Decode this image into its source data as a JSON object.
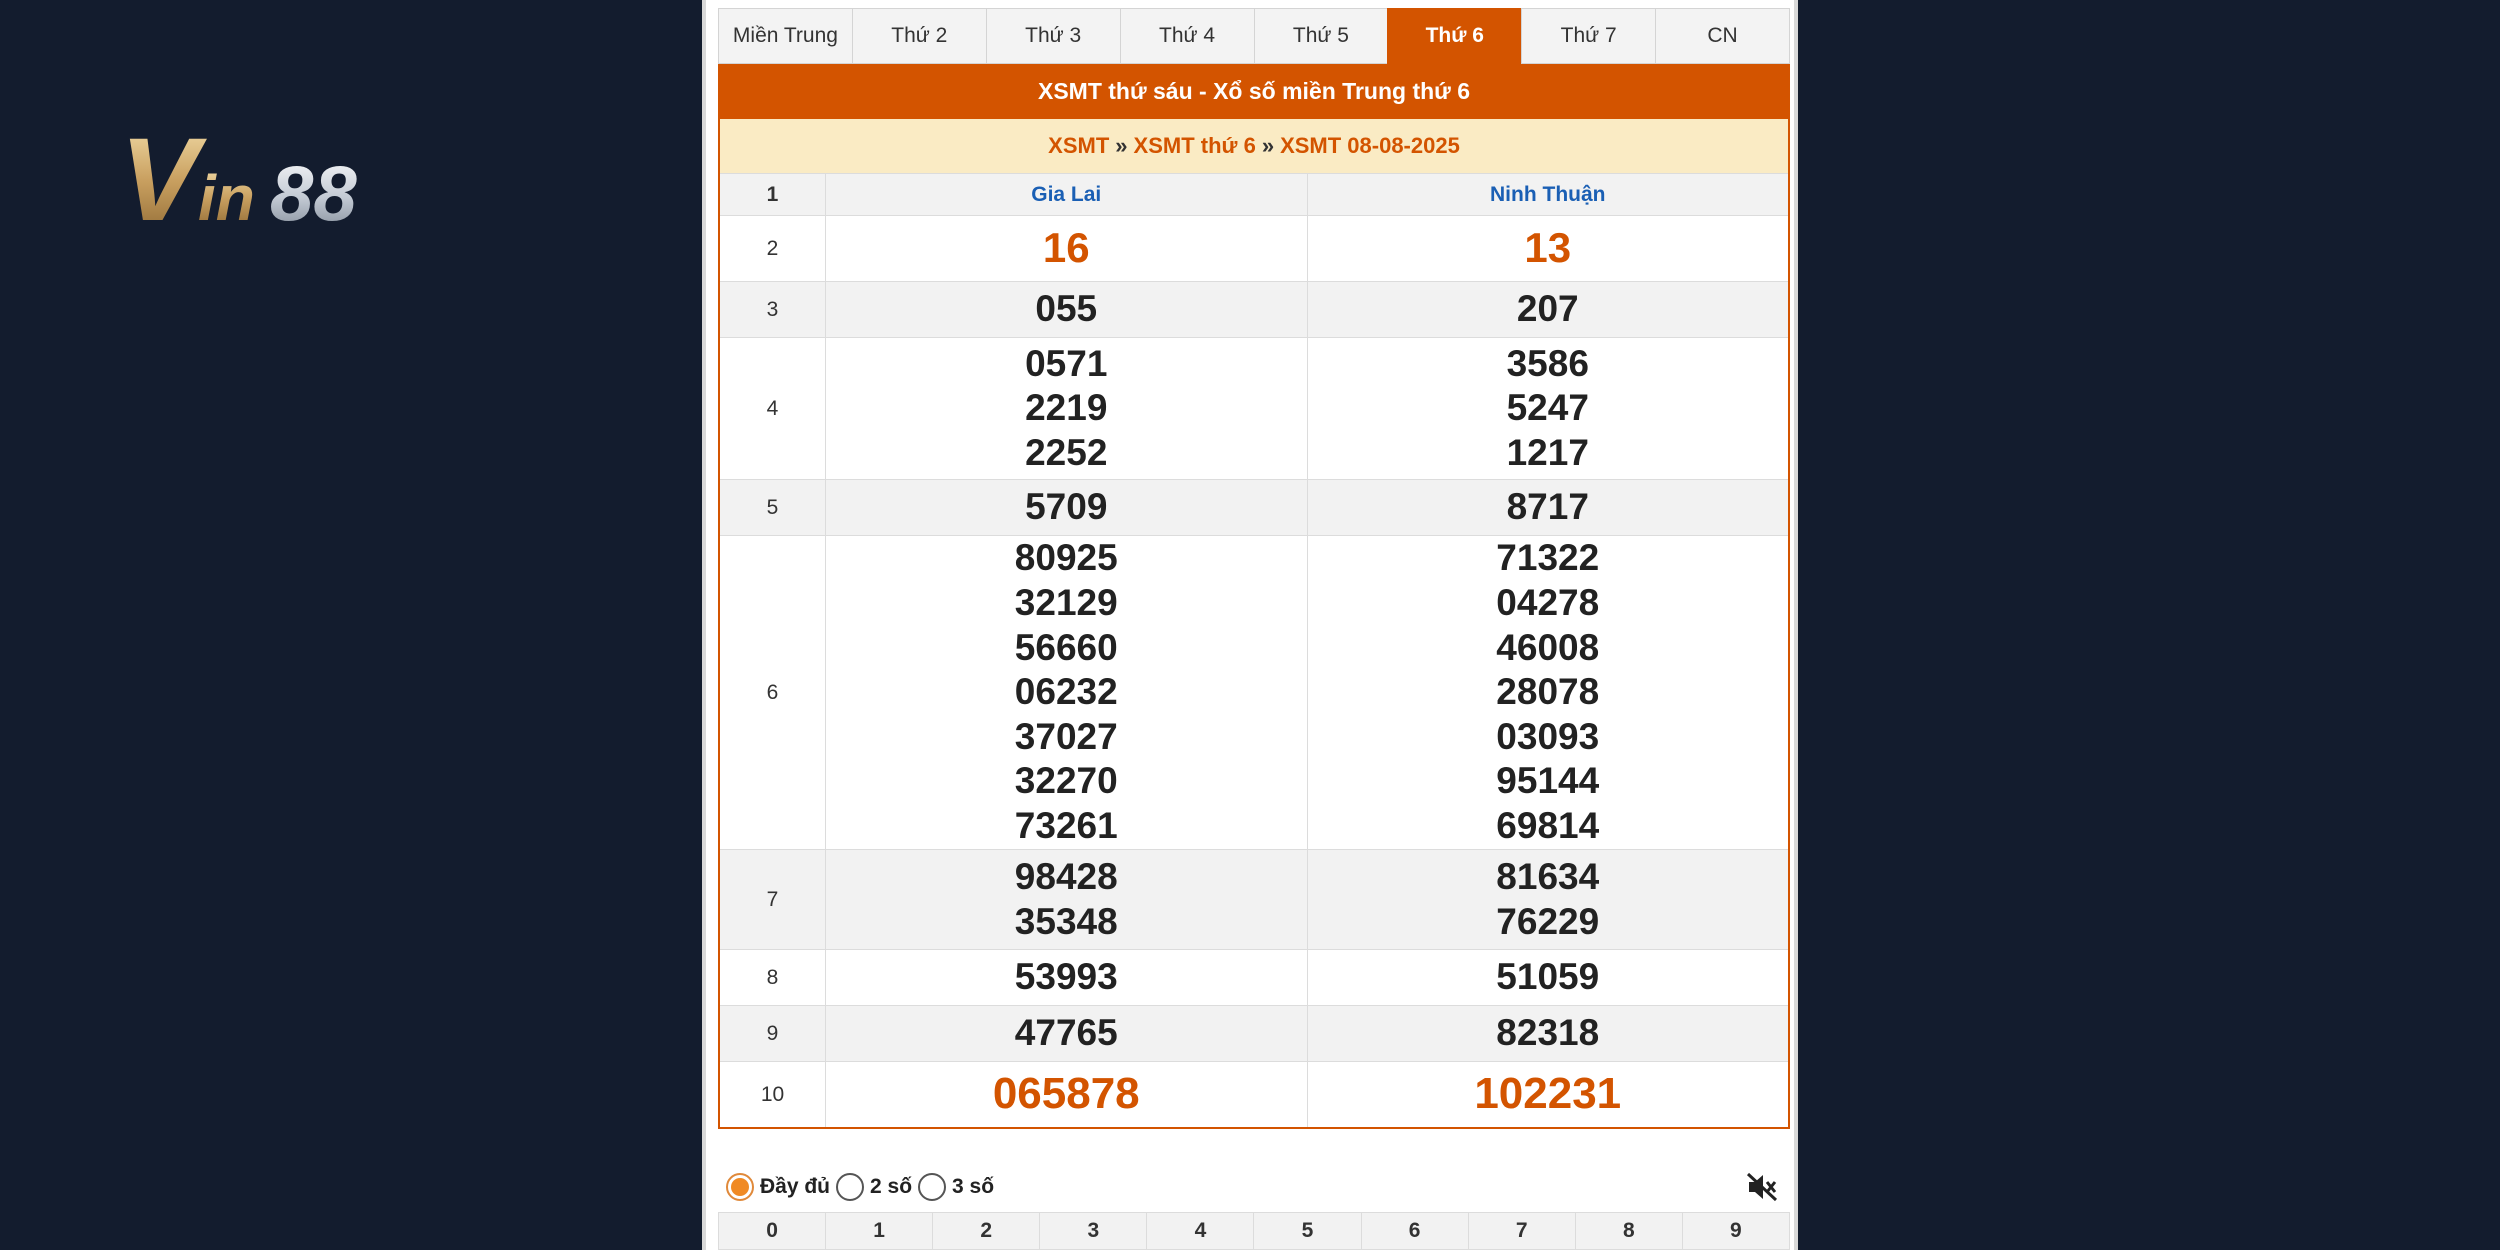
{
  "logo": {
    "text": "Vin88"
  },
  "tabs": [
    {
      "label": "Miền Trung",
      "active": false
    },
    {
      "label": "Thứ 2",
      "active": false
    },
    {
      "label": "Thứ 3",
      "active": false
    },
    {
      "label": "Thứ 4",
      "active": false
    },
    {
      "label": "Thứ 5",
      "active": false
    },
    {
      "label": "Thứ 6",
      "active": true
    },
    {
      "label": "Thứ 7",
      "active": false
    },
    {
      "label": "CN",
      "active": false
    }
  ],
  "title": "XSMT thứ sáu - Xổ số miền Trung thứ 6",
  "breadcrumb": {
    "items": [
      "XSMT",
      "XSMT thứ 6",
      "XSMT 08-08-2025"
    ],
    "separator": "»"
  },
  "header": {
    "index": "1",
    "provinces": [
      "Gia Lai",
      "Ninh Thuận"
    ]
  },
  "rows": [
    {
      "index": "2",
      "style": "hl",
      "values": [
        [
          "16"
        ],
        [
          "13"
        ]
      ]
    },
    {
      "index": "3",
      "style": "",
      "values": [
        [
          "055"
        ],
        [
          "207"
        ]
      ]
    },
    {
      "index": "4",
      "style": "",
      "values": [
        [
          "0571",
          "2219",
          "2252"
        ],
        [
          "3586",
          "5247",
          "1217"
        ]
      ]
    },
    {
      "index": "5",
      "style": "",
      "values": [
        [
          "5709"
        ],
        [
          "8717"
        ]
      ]
    },
    {
      "index": "6",
      "style": "",
      "values": [
        [
          "80925",
          "32129",
          "56660",
          "06232",
          "37027",
          "32270",
          "73261"
        ],
        [
          "71322",
          "04278",
          "46008",
          "28078",
          "03093",
          "95144",
          "69814"
        ]
      ]
    },
    {
      "index": "7",
      "style": "",
      "values": [
        [
          "98428",
          "35348"
        ],
        [
          "81634",
          "76229"
        ]
      ]
    },
    {
      "index": "8",
      "style": "",
      "values": [
        [
          "53993"
        ],
        [
          "51059"
        ]
      ]
    },
    {
      "index": "9",
      "style": "",
      "values": [
        [
          "47765"
        ],
        [
          "82318"
        ]
      ]
    },
    {
      "index": "10",
      "style": "big",
      "values": [
        [
          "065878"
        ],
        [
          "102231"
        ]
      ]
    }
  ],
  "options": [
    {
      "label": "Đầy đủ",
      "checked": true
    },
    {
      "label": "2 số",
      "checked": false
    },
    {
      "label": "3 số",
      "checked": false
    }
  ],
  "mute_icon": "speaker-muted-icon",
  "digits": [
    "0",
    "1",
    "2",
    "3",
    "4",
    "5",
    "6",
    "7",
    "8",
    "9"
  ],
  "colors": {
    "accent": "#d35400",
    "crumb_bg": "#faebc4",
    "header_blue": "#1a5fb4",
    "background": "#131c2e"
  }
}
